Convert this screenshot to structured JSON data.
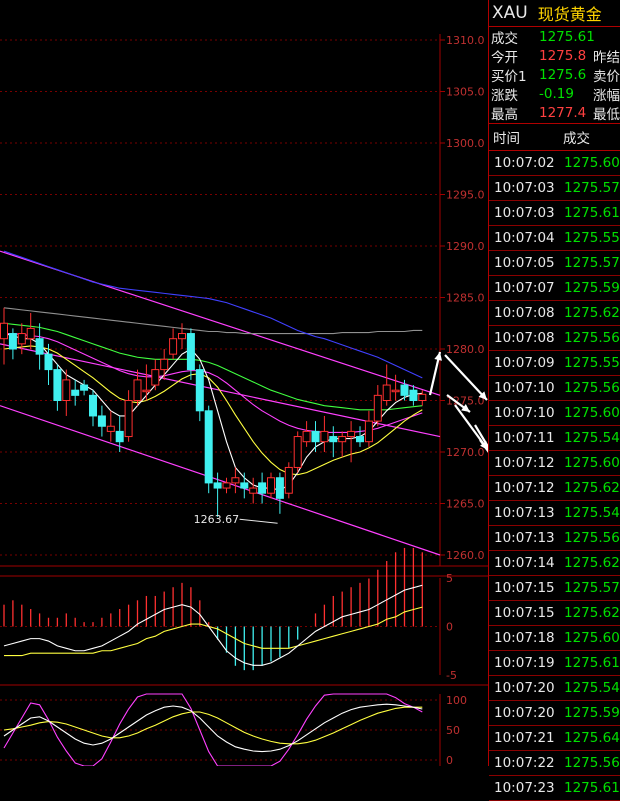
{
  "symbol": "XAU",
  "name": "现货黄金",
  "quote": [
    {
      "label": "成交",
      "value": "1275.61",
      "color": "#00e000",
      "right": ""
    },
    {
      "label": "今开",
      "value": "1275.8",
      "color": "#ff4040",
      "right": "昨结"
    },
    {
      "label": "买价1",
      "value": "1275.6",
      "color": "#00e000",
      "right": "卖价"
    },
    {
      "label": "涨跌",
      "value": "-0.19",
      "color": "#00e000",
      "right": "涨幅"
    },
    {
      "label": "最高",
      "value": "1277.4",
      "color": "#ff4040",
      "right": "最低"
    }
  ],
  "ticks_header": {
    "time": "时间",
    "price": "成交"
  },
  "ticks": [
    {
      "time": "10:07:02",
      "price": "1275.60"
    },
    {
      "time": "10:07:03",
      "price": "1275.57"
    },
    {
      "time": "10:07:03",
      "price": "1275.61"
    },
    {
      "time": "10:07:04",
      "price": "1275.55"
    },
    {
      "time": "10:07:05",
      "price": "1275.57"
    },
    {
      "time": "10:07:07",
      "price": "1275.59"
    },
    {
      "time": "10:07:08",
      "price": "1275.62"
    },
    {
      "time": "10:07:08",
      "price": "1275.56"
    },
    {
      "time": "10:07:09",
      "price": "1275.55"
    },
    {
      "time": "10:07:10",
      "price": "1275.56"
    },
    {
      "time": "10:07:10",
      "price": "1275.60"
    },
    {
      "time": "10:07:11",
      "price": "1275.54"
    },
    {
      "time": "10:07:12",
      "price": "1275.60"
    },
    {
      "time": "10:07:12",
      "price": "1275.62"
    },
    {
      "time": "10:07:13",
      "price": "1275.54"
    },
    {
      "time": "10:07:13",
      "price": "1275.56"
    },
    {
      "time": "10:07:14",
      "price": "1275.62"
    },
    {
      "time": "10:07:15",
      "price": "1275.57"
    },
    {
      "time": "10:07:15",
      "price": "1275.62"
    },
    {
      "time": "10:07:18",
      "price": "1275.60"
    },
    {
      "time": "10:07:19",
      "price": "1275.61"
    },
    {
      "time": "10:07:20",
      "price": "1275.54"
    },
    {
      "time": "10:07:20",
      "price": "1275.59"
    },
    {
      "time": "10:07:21",
      "price": "1275.64"
    },
    {
      "time": "10:07:22",
      "price": "1275.56"
    },
    {
      "time": "10:07:23",
      "price": "1275.61"
    }
  ],
  "chart_data": {
    "type": "candlestick",
    "colors": {
      "up": "#ff3030",
      "down": "#40f0f0",
      "grid": "#a00000",
      "axis_text": "#c03030",
      "ma_white": "#ffffff",
      "ma_yellow": "#ffff40",
      "ma_magenta": "#ff40ff",
      "ma_green": "#40ff40",
      "ma_blue": "#4040ff",
      "ma_gray": "#909090"
    },
    "price_axis": {
      "ticks": [
        "1310.0",
        "1305.0",
        "1300.0",
        "1295.0",
        "1290.0",
        "1285.0",
        "1280.0",
        "1275.0",
        "1270.0",
        "1265.0",
        "1260.0"
      ],
      "ylim": [
        1260,
        1310
      ]
    },
    "low_annotation": "1263.67",
    "candles": [
      {
        "o": 1281.0,
        "c": 1282.5,
        "h": 1284.0,
        "l": 1278.5
      },
      {
        "o": 1281.5,
        "c": 1280.0,
        "h": 1282.0,
        "l": 1279.0
      },
      {
        "o": 1280.5,
        "c": 1281.5,
        "h": 1282.5,
        "l": 1279.5
      },
      {
        "o": 1281.0,
        "c": 1282.0,
        "h": 1283.5,
        "l": 1280.0
      },
      {
        "o": 1281.0,
        "c": 1279.5,
        "h": 1282.5,
        "l": 1278.0
      },
      {
        "o": 1279.5,
        "c": 1278.0,
        "h": 1280.5,
        "l": 1276.5
      },
      {
        "o": 1278.0,
        "c": 1275.0,
        "h": 1278.5,
        "l": 1274.0
      },
      {
        "o": 1275.0,
        "c": 1277.0,
        "h": 1278.0,
        "l": 1273.5
      },
      {
        "o": 1276.0,
        "c": 1275.5,
        "h": 1277.0,
        "l": 1274.5
      },
      {
        "o": 1276.5,
        "c": 1276.0,
        "h": 1277.0,
        "l": 1275.5
      },
      {
        "o": 1275.5,
        "c": 1273.5,
        "h": 1276.0,
        "l": 1272.5
      },
      {
        "o": 1273.5,
        "c": 1272.5,
        "h": 1274.5,
        "l": 1271.5
      },
      {
        "o": 1272.0,
        "c": 1272.5,
        "h": 1274.0,
        "l": 1271.0
      },
      {
        "o": 1272.0,
        "c": 1271.0,
        "h": 1273.5,
        "l": 1270.0
      },
      {
        "o": 1271.5,
        "c": 1275.0,
        "h": 1276.0,
        "l": 1271.0
      },
      {
        "o": 1275.0,
        "c": 1277.0,
        "h": 1278.0,
        "l": 1274.5
      },
      {
        "o": 1276.0,
        "c": 1276.0,
        "h": 1278.5,
        "l": 1275.0
      },
      {
        "o": 1276.5,
        "c": 1278.0,
        "h": 1279.0,
        "l": 1276.0
      },
      {
        "o": 1278.0,
        "c": 1279.0,
        "h": 1280.0,
        "l": 1277.0
      },
      {
        "o": 1279.5,
        "c": 1281.0,
        "h": 1282.0,
        "l": 1279.0
      },
      {
        "o": 1281.0,
        "c": 1281.5,
        "h": 1282.5,
        "l": 1280.0
      },
      {
        "o": 1281.5,
        "c": 1278.0,
        "h": 1282.0,
        "l": 1277.0
      },
      {
        "o": 1278.0,
        "c": 1274.0,
        "h": 1278.5,
        "l": 1273.0
      },
      {
        "o": 1274.0,
        "c": 1267.0,
        "h": 1274.5,
        "l": 1266.0
      },
      {
        "o": 1267.0,
        "c": 1266.5,
        "h": 1268.0,
        "l": 1263.7
      },
      {
        "o": 1266.5,
        "c": 1267.0,
        "h": 1267.5,
        "l": 1266.0
      },
      {
        "o": 1267.0,
        "c": 1267.5,
        "h": 1268.5,
        "l": 1266.0
      },
      {
        "o": 1267.0,
        "c": 1266.5,
        "h": 1268.0,
        "l": 1265.5
      },
      {
        "o": 1266.0,
        "c": 1266.5,
        "h": 1267.5,
        "l": 1265.0
      },
      {
        "o": 1267.0,
        "c": 1266.0,
        "h": 1268.0,
        "l": 1265.0
      },
      {
        "o": 1266.0,
        "c": 1267.5,
        "h": 1268.0,
        "l": 1265.5
      },
      {
        "o": 1267.5,
        "c": 1265.5,
        "h": 1268.0,
        "l": 1264.0
      },
      {
        "o": 1266.0,
        "c": 1268.5,
        "h": 1269.0,
        "l": 1265.5
      },
      {
        "o": 1268.5,
        "c": 1271.5,
        "h": 1272.0,
        "l": 1268.0
      },
      {
        "o": 1271.0,
        "c": 1272.0,
        "h": 1273.0,
        "l": 1270.5
      },
      {
        "o": 1272.0,
        "c": 1271.0,
        "h": 1273.0,
        "l": 1270.0
      },
      {
        "o": 1271.0,
        "c": 1272.0,
        "h": 1273.5,
        "l": 1270.0
      },
      {
        "o": 1271.5,
        "c": 1271.0,
        "h": 1272.5,
        "l": 1269.5
      },
      {
        "o": 1271.0,
        "c": 1271.5,
        "h": 1272.0,
        "l": 1269.5
      },
      {
        "o": 1271.5,
        "c": 1272.0,
        "h": 1273.0,
        "l": 1269.0
      },
      {
        "o": 1271.5,
        "c": 1271.0,
        "h": 1272.5,
        "l": 1270.5
      },
      {
        "o": 1271.0,
        "c": 1273.0,
        "h": 1274.0,
        "l": 1270.5
      },
      {
        "o": 1273.0,
        "c": 1275.5,
        "h": 1276.5,
        "l": 1272.5
      },
      {
        "o": 1275.0,
        "c": 1276.5,
        "h": 1278.5,
        "l": 1274.5
      },
      {
        "o": 1276.0,
        "c": 1276.0,
        "h": 1277.5,
        "l": 1275.0
      },
      {
        "o": 1276.5,
        "c": 1275.5,
        "h": 1277.0,
        "l": 1275.0
      },
      {
        "o": 1276.0,
        "c": 1275.0,
        "h": 1276.5,
        "l": 1274.5
      },
      {
        "o": 1275.0,
        "c": 1275.6,
        "h": 1276.0,
        "l": 1274.5
      }
    ],
    "ma_white": [
      1281.5,
      1281.3,
      1281.0,
      1281.0,
      1280.5,
      1279.5,
      1278.5,
      1277.5,
      1277.0,
      1276.5,
      1276.0,
      1275.0,
      1274.0,
      1273.5,
      1273.5,
      1274.5,
      1275.5,
      1276.5,
      1277.5,
      1278.5,
      1279.5,
      1280.0,
      1279.0,
      1277.0,
      1274.0,
      1271.0,
      1268.5,
      1267.5,
      1266.8,
      1266.5,
      1266.5,
      1266.3,
      1266.8,
      1268.0,
      1269.5,
      1270.5,
      1271.0,
      1271.3,
      1271.3,
      1271.3,
      1271.5,
      1272.0,
      1273.0,
      1274.0,
      1274.8,
      1275.3,
      1275.6,
      1275.7
    ],
    "ma_yellow": [
      1280.0,
      1280.1,
      1280.2,
      1280.3,
      1280.2,
      1280.0,
      1279.6,
      1279.0,
      1278.4,
      1277.8,
      1277.2,
      1276.5,
      1275.8,
      1275.2,
      1274.9,
      1274.8,
      1275.0,
      1275.4,
      1275.9,
      1276.5,
      1277.1,
      1277.5,
      1277.6,
      1277.2,
      1276.3,
      1275.0,
      1273.6,
      1272.3,
      1271.0,
      1269.9,
      1269.0,
      1268.3,
      1267.9,
      1267.8,
      1268.0,
      1268.4,
      1268.8,
      1269.2,
      1269.5,
      1269.8,
      1270.0,
      1270.4,
      1270.9,
      1271.6,
      1272.3,
      1273.0,
      1273.6,
      1274.1
    ],
    "ma_magenta": [
      1281.5,
      1281.5,
      1281.4,
      1281.3,
      1281.2,
      1281.0,
      1280.7,
      1280.3,
      1279.9,
      1279.5,
      1279.1,
      1278.7,
      1278.3,
      1277.9,
      1277.6,
      1277.4,
      1277.3,
      1277.3,
      1277.4,
      1277.6,
      1277.8,
      1277.9,
      1277.9,
      1277.7,
      1277.3,
      1276.7,
      1276.0,
      1275.3,
      1274.6,
      1274.0,
      1273.5,
      1273.0,
      1272.6,
      1272.3,
      1272.1,
      1272.0,
      1271.9,
      1271.9,
      1271.9,
      1271.9,
      1272.0,
      1272.1,
      1272.3,
      1272.6,
      1272.9,
      1273.2,
      1273.5,
      1273.8
    ],
    "ma_green": [
      1282.5,
      1282.4,
      1282.3,
      1282.2,
      1282.1,
      1281.9,
      1281.7,
      1281.4,
      1281.1,
      1280.8,
      1280.5,
      1280.2,
      1279.9,
      1279.6,
      1279.4,
      1279.2,
      1279.1,
      1279.0,
      1279.0,
      1279.0,
      1279.0,
      1279.0,
      1278.9,
      1278.7,
      1278.4,
      1278.0,
      1277.6,
      1277.2,
      1276.8,
      1276.4,
      1276.0,
      1275.7,
      1275.4,
      1275.1,
      1274.9,
      1274.7,
      1274.5,
      1274.4,
      1274.3,
      1274.2,
      1274.1,
      1274.1,
      1274.1,
      1274.1,
      1274.2,
      1274.3,
      1274.4,
      1274.5
    ],
    "ma_blue": [
      1289.5,
      1289.2,
      1288.9,
      1288.6,
      1288.3,
      1288.0,
      1287.7,
      1287.4,
      1287.1,
      1286.8,
      1286.5,
      1286.3,
      1286.1,
      1285.9,
      1285.8,
      1285.7,
      1285.6,
      1285.5,
      1285.4,
      1285.3,
      1285.2,
      1285.1,
      1285.0,
      1284.9,
      1284.7,
      1284.5,
      1284.2,
      1283.9,
      1283.6,
      1283.3,
      1283.0,
      1282.6,
      1282.2,
      1281.8,
      1281.5,
      1281.2,
      1281.0,
      1280.7,
      1280.4,
      1280.1,
      1279.8,
      1279.5,
      1279.2,
      1278.8,
      1278.4,
      1278.0,
      1277.6,
      1277.2
    ],
    "ma_gray": [
      1284.0,
      1283.9,
      1283.8,
      1283.7,
      1283.6,
      1283.5,
      1283.4,
      1283.3,
      1283.2,
      1283.1,
      1283.0,
      1282.9,
      1282.8,
      1282.7,
      1282.6,
      1282.5,
      1282.4,
      1282.3,
      1282.2,
      1282.1,
      1282.0,
      1281.9,
      1281.8,
      1281.7,
      1281.7,
      1281.6,
      1281.6,
      1281.5,
      1281.5,
      1281.5,
      1281.5,
      1281.5,
      1281.5,
      1281.5,
      1281.5,
      1281.5,
      1281.5,
      1281.5,
      1281.6,
      1281.6,
      1281.6,
      1281.6,
      1281.7,
      1281.7,
      1281.7,
      1281.7,
      1281.8,
      1281.8
    ],
    "macd_axis": [
      "5",
      "0",
      "-5"
    ],
    "macd_hist": [
      0.5,
      0.6,
      0.5,
      0.4,
      0.3,
      0.2,
      0.2,
      0.3,
      0.2,
      0.1,
      0.1,
      0.2,
      0.3,
      0.4,
      0.5,
      0.6,
      0.7,
      0.7,
      0.8,
      0.9,
      1.0,
      0.9,
      0.6,
      0.1,
      -0.3,
      -0.6,
      -0.9,
      -1.0,
      -1.0,
      -0.9,
      -0.8,
      -0.7,
      -0.5,
      -0.3,
      0.0,
      0.3,
      0.5,
      0.7,
      0.8,
      0.9,
      1.0,
      1.1,
      1.3,
      1.5,
      1.7,
      1.8,
      1.8,
      1.7
    ],
    "macd_dif": [
      -0.8,
      -0.7,
      -0.6,
      -0.5,
      -0.5,
      -0.6,
      -0.8,
      -0.9,
      -1.0,
      -1.0,
      -0.9,
      -0.8,
      -0.6,
      -0.4,
      -0.2,
      0.1,
      0.3,
      0.5,
      0.7,
      0.8,
      0.9,
      0.8,
      0.5,
      0.0,
      -0.5,
      -1.0,
      -1.3,
      -1.5,
      -1.6,
      -1.6,
      -1.5,
      -1.3,
      -1.1,
      -0.8,
      -0.5,
      -0.2,
      0.0,
      0.2,
      0.4,
      0.5,
      0.6,
      0.7,
      0.9,
      1.1,
      1.3,
      1.5,
      1.6,
      1.7
    ],
    "macd_dea": [
      -1.2,
      -1.2,
      -1.2,
      -1.1,
      -1.1,
      -1.1,
      -1.1,
      -1.1,
      -1.1,
      -1.1,
      -1.1,
      -1.0,
      -1.0,
      -0.9,
      -0.8,
      -0.7,
      -0.5,
      -0.4,
      -0.2,
      -0.1,
      0.0,
      0.1,
      0.1,
      0.0,
      -0.1,
      -0.3,
      -0.5,
      -0.7,
      -0.8,
      -0.9,
      -0.9,
      -0.9,
      -0.9,
      -0.8,
      -0.7,
      -0.6,
      -0.5,
      -0.4,
      -0.3,
      -0.2,
      -0.1,
      0.0,
      0.1,
      0.3,
      0.4,
      0.6,
      0.7,
      0.8
    ],
    "kdj_axis": [
      "100",
      "50",
      "0"
    ],
    "kdj_k": [
      40,
      50,
      60,
      70,
      72,
      65,
      55,
      45,
      35,
      28,
      25,
      28,
      35,
      45,
      55,
      65,
      75,
      82,
      88,
      90,
      88,
      82,
      70,
      55,
      40,
      30,
      22,
      18,
      15,
      14,
      15,
      18,
      24,
      32,
      42,
      52,
      62,
      70,
      78,
      84,
      88,
      90,
      92,
      93,
      92,
      90,
      88,
      85
    ],
    "kdj_d": [
      50,
      52,
      55,
      58,
      62,
      64,
      63,
      60,
      55,
      50,
      45,
      40,
      37,
      37,
      40,
      45,
      52,
      58,
      65,
      72,
      77,
      80,
      80,
      76,
      70,
      62,
      54,
      46,
      40,
      35,
      31,
      28,
      27,
      27,
      29,
      33,
      39,
      45,
      52,
      59,
      66,
      72,
      78,
      82,
      86,
      88,
      88,
      88
    ],
    "kdj_j": [
      20,
      45,
      70,
      95,
      92,
      67,
      38,
      15,
      -5,
      -15,
      -15,
      2,
      30,
      60,
      85,
      105,
      120,
      130,
      134,
      126,
      110,
      86,
      50,
      14,
      -20,
      -35,
      -40,
      -38,
      -35,
      -28,
      -18,
      -2,
      18,
      42,
      68,
      90,
      108,
      120,
      130,
      134,
      132,
      126,
      120,
      115,
      104,
      94,
      88,
      80
    ]
  }
}
